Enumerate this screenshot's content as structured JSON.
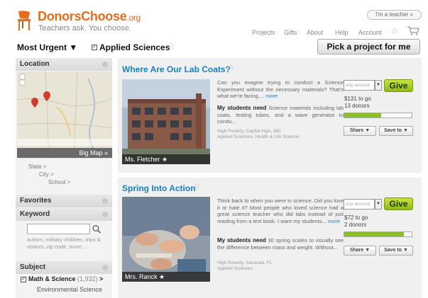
{
  "header": {
    "brand": "DonorsChoose",
    "brand_suffix": ".org",
    "tagline": "Teachers ask. You choose.",
    "teacher_button": "I'm a teacher »",
    "nav": [
      "Projects",
      "Gifts",
      "About",
      "Help",
      "Account"
    ],
    "favorite_icon": "star-icon",
    "cart_icon": "cart-icon"
  },
  "filters": {
    "sort_label": "Most Urgent ▼",
    "subject_checked": "✓",
    "subject_label": "Applied Sciences",
    "pick_button": "Pick a project for me"
  },
  "sidebar": {
    "location": {
      "title": "Location",
      "big_map": "Big Map »",
      "links": [
        "State >",
        "City >",
        "School >"
      ]
    },
    "favorites_title": "Favorites",
    "keyword": {
      "title": "Keyword",
      "placeholder": "",
      "hint": "autism, military children, trips & visitors, zip code, more..."
    },
    "subject": {
      "title": "Subject",
      "checked": "✓",
      "item_label": "Math & Science",
      "item_count": "(1,932)",
      "arrow": ">",
      "sub_item": "Environmental Science"
    }
  },
  "projects": [
    {
      "title": "Where Are Our Lab Coats?",
      "teacher": "Ms. Fletcher ★",
      "summary": "Can you imagine trying to conduct a Science Experiment without the necessary materials? That's what we're facing....",
      "more": "more",
      "need_label": "My students need",
      "need_text": "Science materials including lab coats, testing tubes, and a wave generator to condu...",
      "poverty": "High Poverty, Capitol Hgts, MD",
      "subjects": "Applied Sciences, Health & Life Science",
      "amount_placeholder": "any amount",
      "give": "Give",
      "to_go": "$131 to go",
      "donors": "13 donors",
      "progress": 0.55,
      "share": "Share ▼",
      "save": "Save to ▼"
    },
    {
      "title": "Spring Into Action",
      "teacher": "Mrs. Ranck ★",
      "summary": "Think back to when you were in science. Did you love it or hate it? Most people who loved science had a great science teacher who did labs instead of just reading from a text book. I want my students...",
      "more": "more",
      "need_label": "My students need",
      "need_text": "30 spring scales to visually see the difference between mass and weight. Without...",
      "poverty": "High Poverty, Sarasota, FL",
      "subjects": "Applied Sciences",
      "amount_placeholder": "any amount",
      "give": "Give",
      "to_go": "$72 to go",
      "donors": "2 donors",
      "progress": 0.88,
      "share": "Share ▼",
      "save": "Save to ▼"
    }
  ],
  "colors": {
    "brand": "#e86c1d",
    "link": "#1a7fc1",
    "give": "#9cc41e",
    "progress": "#8cbf26"
  }
}
